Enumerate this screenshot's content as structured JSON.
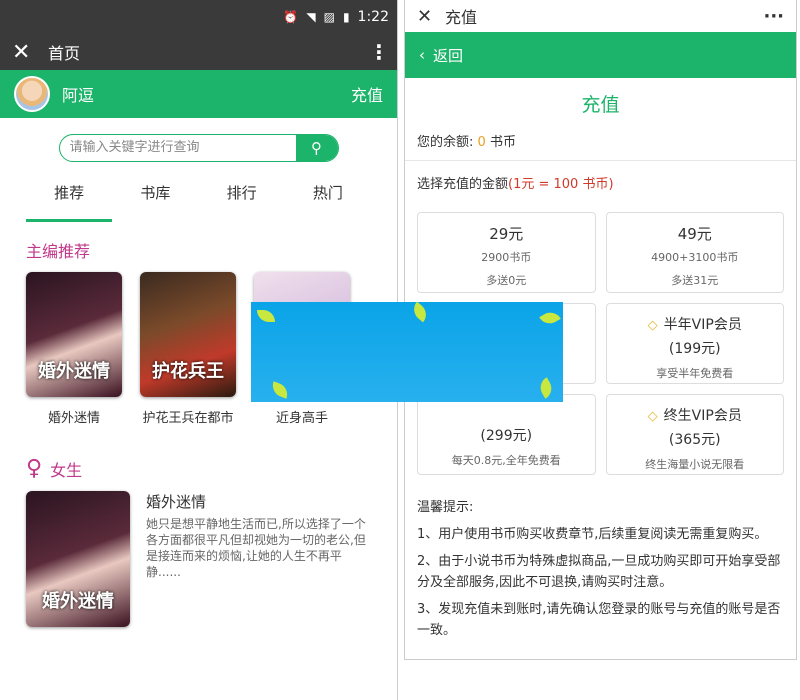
{
  "status_bar": {
    "time": "1:22"
  },
  "left": {
    "title": "首页",
    "user": {
      "name": "阿逗",
      "recharge": "充值"
    },
    "search": {
      "placeholder": "请输入关键字进行查询"
    },
    "tabs": [
      "推荐",
      "书库",
      "排行",
      "热门"
    ],
    "editor_section": "主编推荐",
    "books": [
      {
        "title": "婚外迷情",
        "cover_text": "婚外迷情"
      },
      {
        "title": "护花王兵在都市",
        "cover_text": "护花兵王"
      },
      {
        "title": "近身高手",
        "cover_text": ""
      }
    ],
    "female_section": "女生",
    "featured": {
      "title": "婚外迷情",
      "desc": "她只是想平静地生活而已,所以选择了一个各方面都很平凡但却视她为一切的老公,但是接连而来的烦恼,让她的人生不再平静......",
      "cover_text": "婚外迷情"
    }
  },
  "right": {
    "title": "充值",
    "back": "返回",
    "heading": "充值",
    "balance_label": "您的余额:",
    "balance_value": "0",
    "balance_unit": "书币",
    "select_label": "选择充值的金额",
    "rate": "(1元 = 100 书币)",
    "options": [
      {
        "price": "29元",
        "coins": "2900书币",
        "bonus": "多送0元"
      },
      {
        "price": "49元",
        "coins": "4900+3100书币",
        "bonus": "多送31元"
      },
      {
        "price": "",
        "coins": "",
        "bonus": ""
      },
      {
        "vip": "半年VIP会员",
        "price": "(199元)",
        "bonus": "享受半年免费看"
      },
      {
        "vip": "",
        "price": "(299元)",
        "bonus": "每天0.8元,全年免费看"
      },
      {
        "vip": "终生VIP会员",
        "price": "(365元)",
        "bonus": "终生海量小说无限看"
      }
    ],
    "tips_title": "温馨提示:",
    "tips": [
      "1、用户使用书币购买收费章节,后续重复阅读无需重复购买。",
      "2、由于小说书币为特殊虚拟商品,一旦成功购买即可开始享受部分及全部服务,因此不可退换,请购买时注意。",
      "3、发现充值未到账时,请先确认您登录的账号与充值的账号是否一致。"
    ]
  }
}
